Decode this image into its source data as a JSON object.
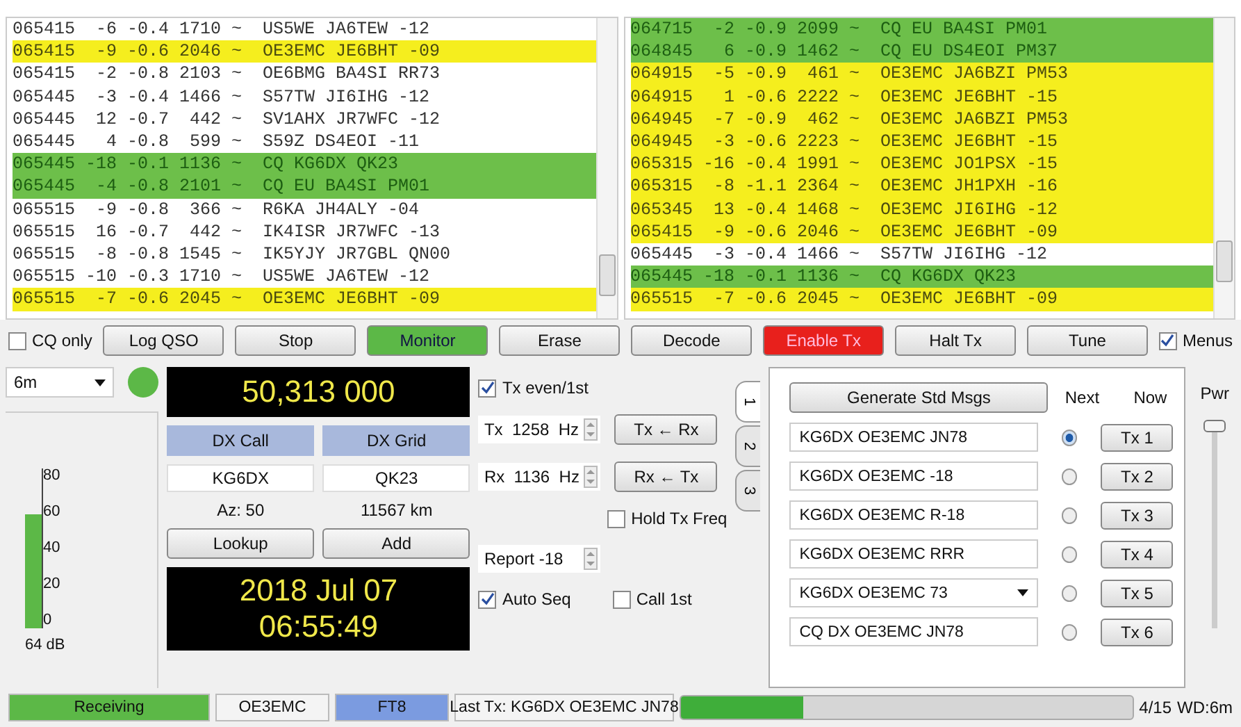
{
  "decodes_left": [
    {
      "text": "065415  -6 -0.4 1710 ~  US5WE JA6TEW -12",
      "kind": "plain"
    },
    {
      "text": "065415  -9 -0.6 2046 ~  OE3EMC JE6BHT -09",
      "kind": "to_me"
    },
    {
      "text": "065415  -2 -0.8 2103 ~  OE6BMG BA4SI RR73",
      "kind": "plain"
    },
    {
      "text": "065445  -3 -0.4 1466 ~  S57TW JI6IHG -12",
      "kind": "plain"
    },
    {
      "text": "065445  12 -0.7  442 ~  SV1AHX JR7WFC -12",
      "kind": "plain"
    },
    {
      "text": "065445   4 -0.8  599 ~  S59Z DS4EOI -11",
      "kind": "plain"
    },
    {
      "text": "065445 -18 -0.1 1136 ~  CQ KG6DX QK23",
      "kind": "cq"
    },
    {
      "text": "065445  -4 -0.8 2101 ~  CQ EU BA4SI PM01",
      "kind": "cq"
    },
    {
      "text": "065515  -9 -0.8  366 ~  R6KA JH4ALY -04",
      "kind": "plain"
    },
    {
      "text": "065515  16 -0.7  442 ~  IK4ISR JR7WFC -13",
      "kind": "plain"
    },
    {
      "text": "065515  -8 -0.8 1545 ~  IK5YJY JR7GBL QN00",
      "kind": "plain"
    },
    {
      "text": "065515 -10 -0.3 1710 ~  US5WE JA6TEW -12",
      "kind": "plain"
    },
    {
      "text": "065515  -7 -0.6 2045 ~  OE3EMC JE6BHT -09",
      "kind": "to_me"
    }
  ],
  "decodes_right": [
    {
      "text": "064715  -2 -0.9 2099 ~  CQ EU BA4SI PM01",
      "kind": "cq"
    },
    {
      "text": "064845   6 -0.9 1462 ~  CQ EU DS4EOI PM37",
      "kind": "cq"
    },
    {
      "text": "064915  -5 -0.9  461 ~  OE3EMC JA6BZI PM53",
      "kind": "to_me"
    },
    {
      "text": "064915   1 -0.6 2222 ~  OE3EMC JE6BHT -15",
      "kind": "to_me"
    },
    {
      "text": "064945  -7 -0.9  462 ~  OE3EMC JA6BZI PM53",
      "kind": "to_me"
    },
    {
      "text": "064945  -3 -0.6 2223 ~  OE3EMC JE6BHT -15",
      "kind": "to_me"
    },
    {
      "text": "065315 -16 -0.4 1991 ~  OE3EMC JO1PSX -15",
      "kind": "to_me"
    },
    {
      "text": "065315  -8 -1.1 2364 ~  OE3EMC JH1PXH -16",
      "kind": "to_me"
    },
    {
      "text": "065345  13 -0.4 1468 ~  OE3EMC JI6IHG -12",
      "kind": "to_me"
    },
    {
      "text": "065415  -9 -0.6 2046 ~  OE3EMC JE6BHT -09",
      "kind": "to_me"
    },
    {
      "text": "065445  -3 -0.4 1466 ~  S57TW JI6IHG -12",
      "kind": "plain"
    },
    {
      "text": "065445 -18 -0.1 1136 ~  CQ KG6DX QK23",
      "kind": "cq"
    },
    {
      "text": "065515  -7 -0.6 2045 ~  OE3EMC JE6BHT -09",
      "kind": "to_me"
    }
  ],
  "toolbar": [
    {
      "kind": "checkbox",
      "label": "CQ only",
      "checked": false
    },
    {
      "kind": "button",
      "label": "Log QSO"
    },
    {
      "kind": "button",
      "label": "Stop"
    },
    {
      "kind": "monitor_toggle",
      "label": "Monitor",
      "on": true
    },
    {
      "kind": "button",
      "label": "Erase"
    },
    {
      "kind": "button",
      "label": "Decode"
    },
    {
      "kind": "tx_toggle",
      "label": "Enable Tx",
      "on": true
    },
    {
      "kind": "button",
      "label": "Halt Tx"
    },
    {
      "kind": "button",
      "label": "Tune"
    },
    {
      "kind": "checkbox",
      "label": "Menus",
      "checked": true
    }
  ],
  "band": {
    "value": "6m"
  },
  "frequency": "50,313 000",
  "meter": {
    "scale": [
      "80",
      "60",
      "40",
      "20",
      "0"
    ],
    "level": 0.71,
    "reading": "64 dB"
  },
  "dx": {
    "call_label": "DX Call",
    "grid_label": "DX Grid",
    "call": "KG6DX",
    "grid": "QK23",
    "azimuth": "Az: 50",
    "distance": "11567 km",
    "lookup": "Lookup",
    "add": "Add"
  },
  "clock": {
    "date": "2018 Jul 07",
    "time": "06:55:49"
  },
  "controls": {
    "tx_even": {
      "label": "Tx even/1st",
      "checked": true
    },
    "tx_freq": "Tx  1258  Hz",
    "rx_freq": "Rx  1136  Hz",
    "tx_from_rx": "Tx ← Rx",
    "rx_from_tx": "Rx ← Tx",
    "hold_tx": {
      "label": "Hold Tx Freq",
      "checked": false
    },
    "report": "Report -18",
    "auto_seq": {
      "label": "Auto Seq",
      "checked": true
    },
    "call_1st": {
      "label": "Call 1st",
      "checked": false
    }
  },
  "tabs": [
    {
      "label": "1",
      "selected": true
    },
    {
      "label": "2",
      "selected": false
    },
    {
      "label": "3",
      "selected": false
    }
  ],
  "messages": {
    "generate": "Generate Std Msgs",
    "next_label": "Next",
    "now_label": "Now",
    "rows": [
      {
        "text": "KG6DX OE3EMC JN78",
        "kind": "field",
        "selected": true,
        "button": "Tx 1"
      },
      {
        "text": "KG6DX OE3EMC -18",
        "kind": "field",
        "selected": false,
        "button": "Tx 2"
      },
      {
        "text": "KG6DX OE3EMC R-18",
        "kind": "field",
        "selected": false,
        "button": "Tx 3"
      },
      {
        "text": "KG6DX OE3EMC RRR",
        "kind": "field",
        "selected": false,
        "button": "Tx 4"
      },
      {
        "text": "KG6DX OE3EMC 73",
        "kind": "dropdown",
        "selected": false,
        "button": "Tx 5"
      },
      {
        "text": "CQ DX OE3EMC JN78",
        "kind": "field",
        "selected": false,
        "button": "Tx 6"
      }
    ]
  },
  "power": {
    "label": "Pwr",
    "level": 1
  },
  "status_bar": {
    "state": "Receiving",
    "call": "OE3EMC",
    "mode": "FT8",
    "last_tx": "Last Tx: KG6DX OE3EMC JN78",
    "progress": {
      "level": 0.27
    },
    "count": "4/15",
    "watchdog": "WD:6m"
  }
}
